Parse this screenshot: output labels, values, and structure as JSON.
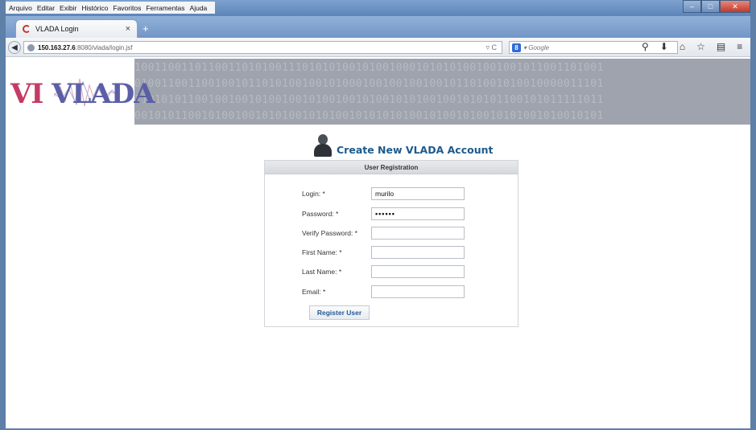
{
  "browser": {
    "menu": [
      "Arquivo",
      "Editar",
      "Exibir",
      "Histórico",
      "Favoritos",
      "Ferramentas",
      "Ajuda"
    ],
    "tab_title": "VLADA Login",
    "tab_close": "×",
    "new_tab": "+",
    "url_host": "150.163.27.6",
    "url_path": ":8080/vlada/login.jsf",
    "search_placeholder": "Google",
    "window_buttons": [
      "–",
      "□",
      "✕"
    ]
  },
  "banner": {
    "logo_vi": "VI",
    "logo_vlada": "VLADA",
    "bits": [
      "1001100110110011010100111010101001010010001010101001001001011001101001",
      "0100110011001001011010100100101000100100100100101101001010010000011101",
      "1101010110010010010100100101001001010010101001001010101100101011111011",
      "0010101100101001001010100101010010101010100101001010010101001010010101"
    ]
  },
  "form": {
    "title": "Create New VLADA Account",
    "panel_header": "User Registration",
    "fields": [
      {
        "label": "Login: *",
        "value": "murilo"
      },
      {
        "label": "Password: *",
        "value": "••••••"
      },
      {
        "label": "Verify Password: *",
        "value": ""
      },
      {
        "label": "First Name: *",
        "value": ""
      },
      {
        "label": "Last Name: *",
        "value": ""
      },
      {
        "label": "Email: *",
        "value": ""
      }
    ],
    "submit_label": "Register User"
  },
  "colors": {
    "accent": "#1d5a8c",
    "window_frame": "#5d7fa8",
    "button_text": "#245a93"
  }
}
